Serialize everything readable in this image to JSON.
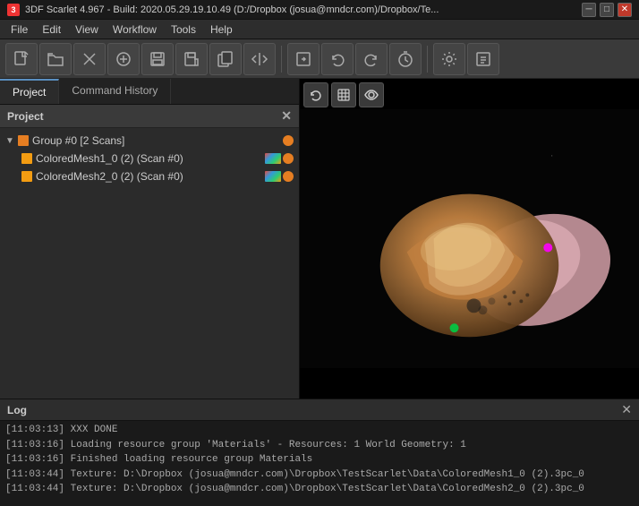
{
  "titlebar": {
    "title": "3DF Scarlet 4.967 - Build: 2020.05.29.19.10.49 (D:/Dropbox (josua@mndcr.com)/Dropbox/Te...",
    "icon": "3",
    "minimize": "─",
    "maximize": "□",
    "close": "✕"
  },
  "menubar": {
    "items": [
      "File",
      "Edit",
      "View",
      "Workflow",
      "Tools",
      "Help"
    ]
  },
  "toolbar": {
    "buttons": [
      {
        "name": "new",
        "icon": "⬜"
      },
      {
        "name": "open",
        "icon": "📁"
      },
      {
        "name": "close-file",
        "icon": "✕"
      },
      {
        "name": "add",
        "icon": "⊕"
      },
      {
        "name": "save",
        "icon": "💾"
      },
      {
        "name": "export",
        "icon": "📋"
      },
      {
        "name": "duplicate",
        "icon": "❐"
      },
      {
        "name": "arrows",
        "icon": "↕"
      },
      {
        "name": "sep1",
        "icon": ""
      },
      {
        "name": "import",
        "icon": "⬛"
      },
      {
        "name": "undo",
        "icon": "↩"
      },
      {
        "name": "redo",
        "icon": "↪"
      },
      {
        "name": "timer",
        "icon": "⏱"
      },
      {
        "name": "sep2",
        "icon": ""
      },
      {
        "name": "settings",
        "icon": "⚙"
      },
      {
        "name": "info",
        "icon": "📖"
      }
    ]
  },
  "left_panel": {
    "tabs": [
      {
        "label": "Project",
        "active": true
      },
      {
        "label": "Command History",
        "active": false
      }
    ],
    "project_header": "Project",
    "tree": {
      "root": {
        "label": "Group #0 [2 Scans]",
        "color": "#e67e22",
        "children": [
          {
            "label": "ColoredMesh1_0 (2) (Scan #0)",
            "color": "#f39c12"
          },
          {
            "label": "ColoredMesh2_0 (2) (Scan #0)",
            "color": "#f39c12"
          }
        ]
      }
    }
  },
  "viewport": {
    "buttons": [
      {
        "name": "reset-view",
        "icon": "↺"
      },
      {
        "name": "wireframe",
        "icon": "⬡"
      },
      {
        "name": "toggle-visibility",
        "icon": "◉"
      }
    ]
  },
  "log": {
    "title": "Log",
    "lines": [
      "[11:03:13] XXX DONE",
      "[11:03:16] Loading resource group 'Materials' - Resources: 1 World Geometry: 1",
      "[11:03:16] Finished loading resource group Materials",
      "[11:03:44] Texture: D:\\Dropbox (josua@mndcr.com)\\Dropbox\\TestScarlet\\Data\\ColoredMesh1_0 (2).3pc_0",
      "[11:03:44] Texture: D:\\Dropbox (josua@mndcr.com)\\Dropbox\\TestScarlet\\Data\\ColoredMesh2_0 (2).3pc_0"
    ]
  }
}
